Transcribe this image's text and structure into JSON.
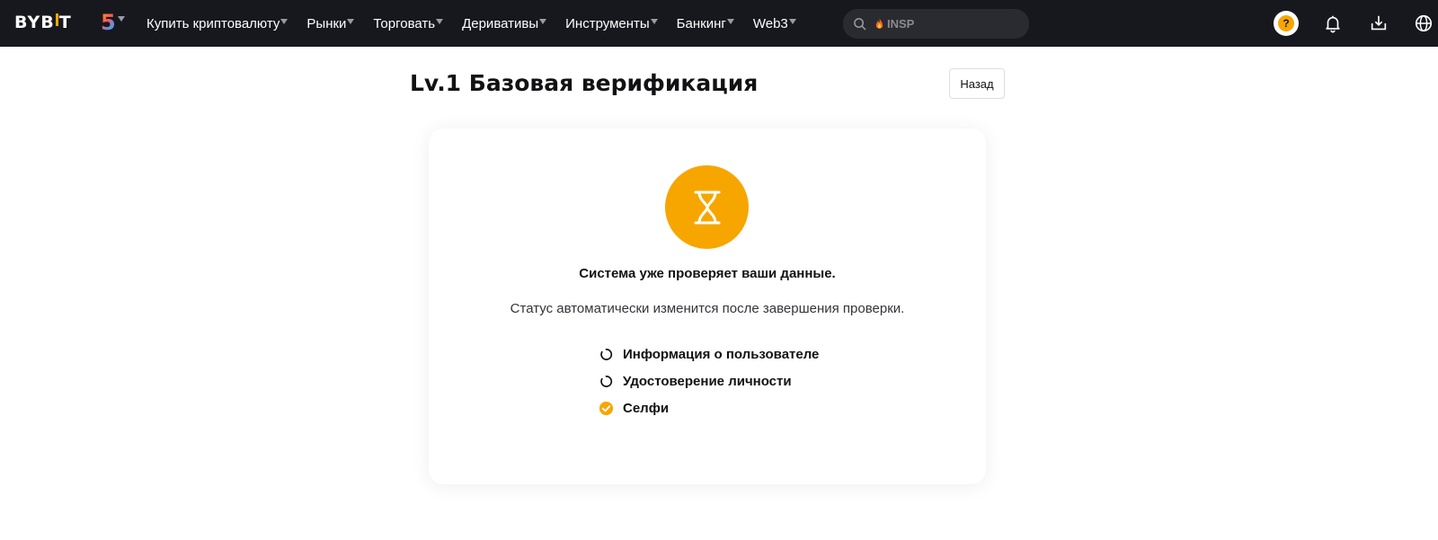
{
  "brand": {
    "logo_text_left": "BYB",
    "logo_text_right": "T"
  },
  "nav": {
    "items": [
      {
        "label": "Купить криптовалюту"
      },
      {
        "label": "Рынки"
      },
      {
        "label": "Торговать"
      },
      {
        "label": "Деривативы"
      },
      {
        "label": "Инструменты"
      },
      {
        "label": "Банкинг"
      },
      {
        "label": "Web3"
      }
    ],
    "badge": "5"
  },
  "search": {
    "value": "INSP",
    "icon": "search-icon",
    "trend_icon": "fire-icon"
  },
  "header_icons": [
    "avatar-icon",
    "bell-icon",
    "download-icon",
    "globe-icon"
  ],
  "avatar": {
    "glyph": "?"
  },
  "page": {
    "title": "Lv.1 Базовая верификация",
    "back_label": "Назад"
  },
  "status": {
    "title": "Система уже проверяет ваши данные.",
    "subtitle": "Статус автоматически изменится после завершения проверки.",
    "icon": "hourglass-icon"
  },
  "steps": [
    {
      "label": "Информация о пользователе",
      "state": "pending",
      "icon": "loading-icon"
    },
    {
      "label": "Удостоверение личности",
      "state": "pending",
      "icon": "loading-icon"
    },
    {
      "label": "Селфи",
      "state": "done",
      "icon": "check-icon"
    }
  ],
  "colors": {
    "accent": "#f7a600",
    "nav_bg": "#17181e",
    "search_bg": "#2a2b31"
  }
}
